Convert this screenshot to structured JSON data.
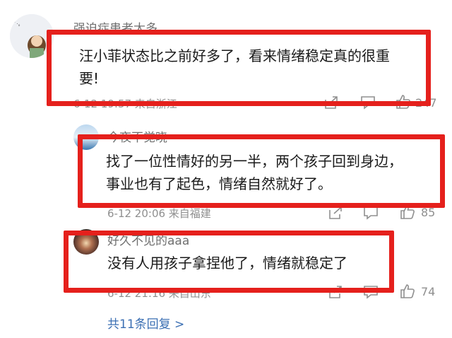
{
  "comments": [
    {
      "username": "强迫症患者太多",
      "text_line1": "汪小菲状态比之前好多了，看来情绪稳定真的很重",
      "text_line2": "要!",
      "meta": "6-12 19:57 来自浙江",
      "like_count": "247"
    },
    {
      "username": "今夜不觉晓",
      "text_line1": "找了一位性情好的另一半，两个孩子回到身边，",
      "text_line2": "事业也有了起色，情绪自然就好了。",
      "meta": "6-12 20:06 来自福建",
      "like_count": "85"
    },
    {
      "username": "好久不见的aaa",
      "text_line1": "没有人用孩子拿捏他了，情绪就稳定了",
      "meta": "6-12 21:16 来自山东",
      "like_count": "74"
    }
  ],
  "replies_link": "共11条回复 >",
  "icons": [
    "share-icon",
    "comment-icon",
    "like-icon"
  ],
  "colors": {
    "highlight_border": "#e5201c",
    "link": "#3b6fb3",
    "meta_text": "#8f8f8f"
  }
}
